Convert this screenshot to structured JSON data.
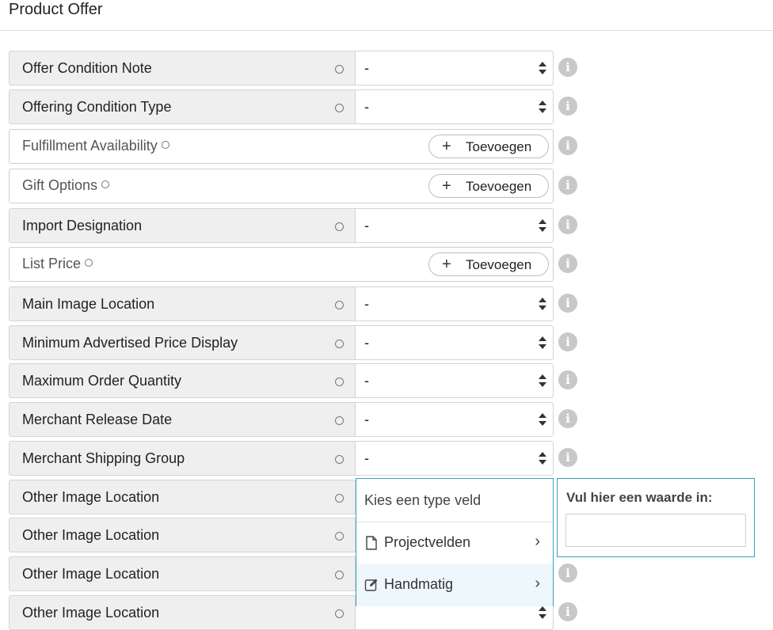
{
  "header": {
    "title": "Product Offer"
  },
  "select_default": "-",
  "add_button_label": "Toevoegen",
  "fields": [
    {
      "label": "Offer Condition Note",
      "kind": "select",
      "value": "-"
    },
    {
      "label": "Offering Condition Type",
      "kind": "select",
      "value": "-"
    },
    {
      "label": "Fulfillment Availability",
      "kind": "add"
    },
    {
      "label": "Gift Options",
      "kind": "add"
    },
    {
      "label": "Import Designation",
      "kind": "select",
      "value": "-"
    },
    {
      "label": "List Price",
      "kind": "add"
    },
    {
      "label": "Main Image Location",
      "kind": "select",
      "value": "-"
    },
    {
      "label": "Minimum Advertised Price Display",
      "kind": "select",
      "value": "-"
    },
    {
      "label": "Maximum Order Quantity",
      "kind": "select",
      "value": "-"
    },
    {
      "label": "Merchant Release Date",
      "kind": "select",
      "value": "-"
    },
    {
      "label": "Merchant Shipping Group",
      "kind": "select",
      "value": "-"
    },
    {
      "label": "Other Image Location",
      "kind": "select",
      "value": ""
    },
    {
      "label": "Other Image Location",
      "kind": "select",
      "value": ""
    },
    {
      "label": "Other Image Location",
      "kind": "select",
      "value": ""
    },
    {
      "label": "Other Image Location",
      "kind": "select",
      "value": ""
    }
  ],
  "dropdown": {
    "header": "Kies een type veld",
    "items": [
      {
        "label": "Projectvelden",
        "icon": "file-icon"
      },
      {
        "label": "Handmatig",
        "icon": "edit-icon",
        "active": true
      }
    ]
  },
  "value_panel": {
    "label": "Vul hier een waarde in:",
    "input_value": ""
  },
  "colors": {
    "label_bg": "#efefef",
    "info_icon": "#c8c8c8",
    "focus_border": "#3a9fc6",
    "active_item_bg": "#eef7fb"
  }
}
